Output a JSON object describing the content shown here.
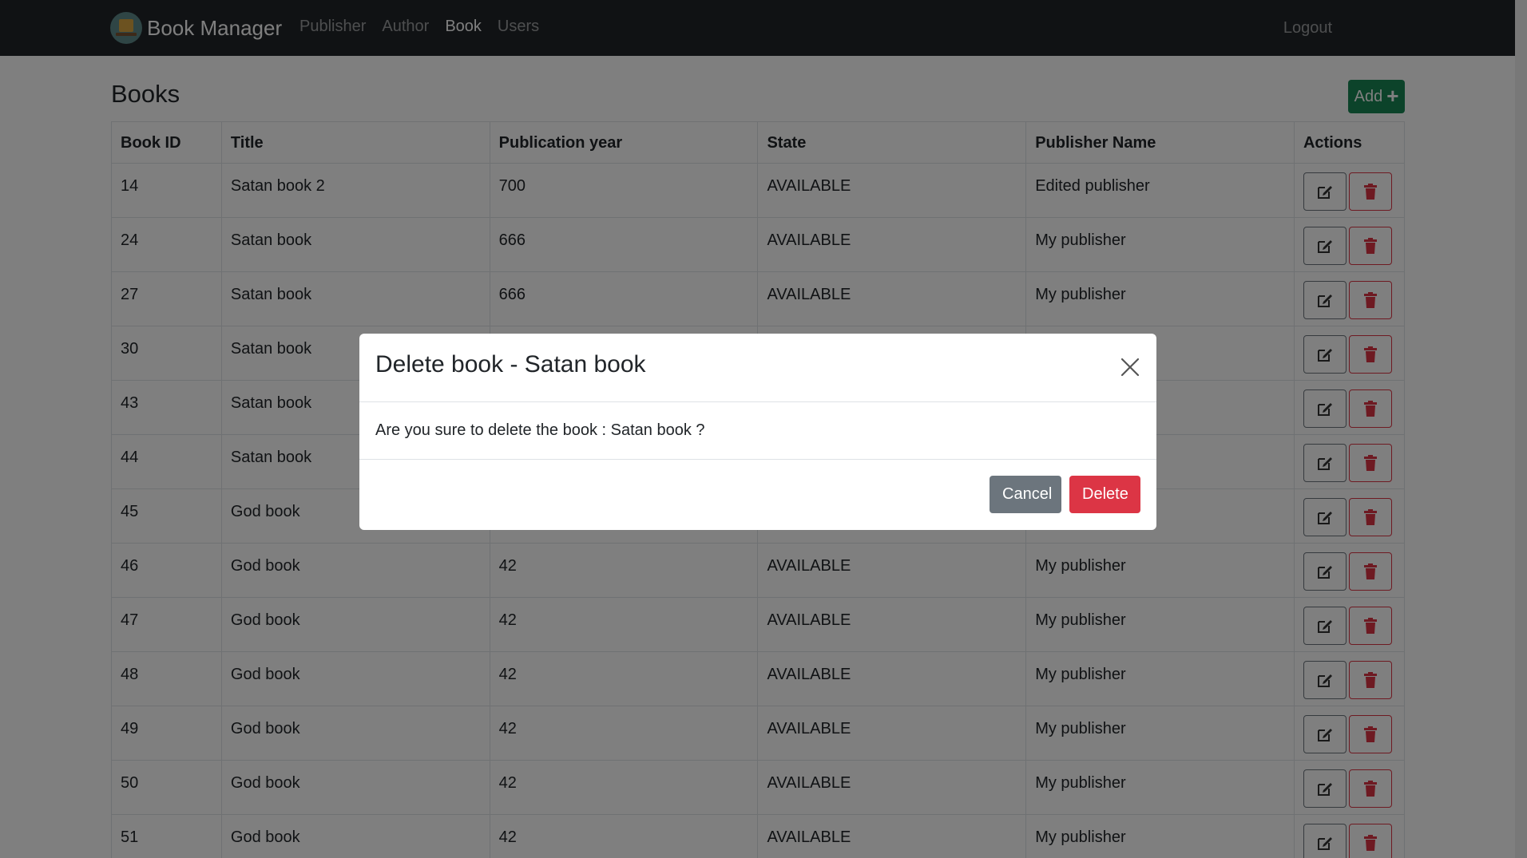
{
  "navbar": {
    "brand": "Book Manager",
    "links": [
      "Publisher",
      "Author",
      "Book",
      "Users"
    ],
    "active": "Book",
    "logout": "Logout"
  },
  "page": {
    "title": "Books",
    "add_label": "Add"
  },
  "table": {
    "headers": [
      "Book ID",
      "Title",
      "Publication year",
      "State",
      "Publisher Name",
      "Actions"
    ],
    "rows": [
      {
        "id": "14",
        "title": "Satan book 2",
        "year": "700",
        "state": "AVAILABLE",
        "publisher": "Edited publisher"
      },
      {
        "id": "24",
        "title": "Satan book",
        "year": "666",
        "state": "AVAILABLE",
        "publisher": "My publisher"
      },
      {
        "id": "27",
        "title": "Satan book",
        "year": "666",
        "state": "AVAILABLE",
        "publisher": "My publisher"
      },
      {
        "id": "30",
        "title": "Satan book",
        "year": "",
        "state": "",
        "publisher": ""
      },
      {
        "id": "43",
        "title": "Satan book",
        "year": "",
        "state": "",
        "publisher": ""
      },
      {
        "id": "44",
        "title": "Satan book",
        "year": "",
        "state": "",
        "publisher": ""
      },
      {
        "id": "45",
        "title": "God book",
        "year": "",
        "state": "",
        "publisher": ""
      },
      {
        "id": "46",
        "title": "God book",
        "year": "42",
        "state": "AVAILABLE",
        "publisher": "My publisher"
      },
      {
        "id": "47",
        "title": "God book",
        "year": "42",
        "state": "AVAILABLE",
        "publisher": "My publisher"
      },
      {
        "id": "48",
        "title": "God book",
        "year": "42",
        "state": "AVAILABLE",
        "publisher": "My publisher"
      },
      {
        "id": "49",
        "title": "God book",
        "year": "42",
        "state": "AVAILABLE",
        "publisher": "My publisher"
      },
      {
        "id": "50",
        "title": "God book",
        "year": "42",
        "state": "AVAILABLE",
        "publisher": "My publisher"
      },
      {
        "id": "51",
        "title": "God book",
        "year": "42",
        "state": "AVAILABLE",
        "publisher": "My publisher"
      }
    ],
    "edit_icon": "edit-icon",
    "delete_icon": "trash-icon"
  },
  "modal": {
    "title": "Delete book - Satan book",
    "body": "Are you sure to delete the book : Satan book ?",
    "cancel_label": "Cancel",
    "delete_label": "Delete"
  },
  "colors": {
    "navbar": "#212529",
    "add": "#198754",
    "danger": "#dc3545",
    "secondary": "#6c757d"
  }
}
